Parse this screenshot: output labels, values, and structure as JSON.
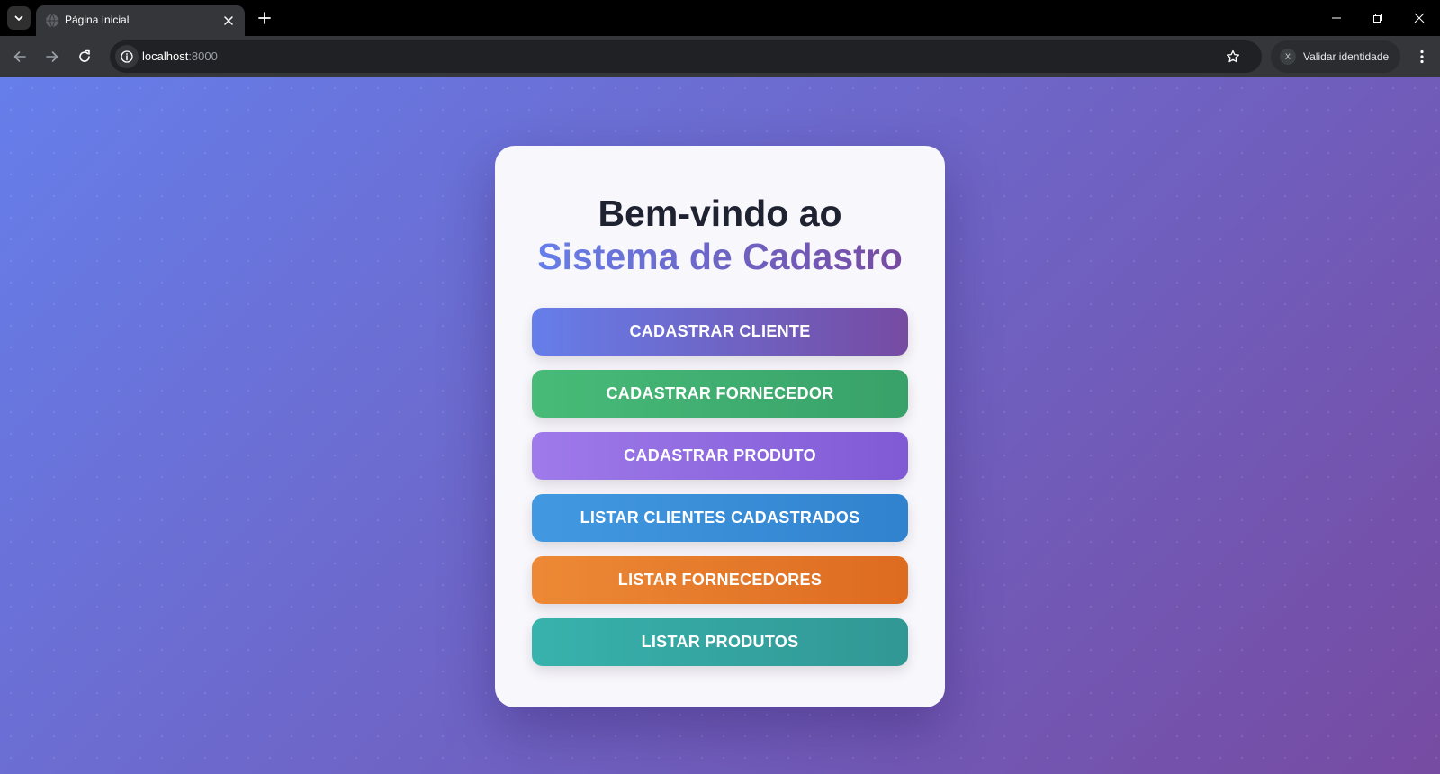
{
  "browser": {
    "tab": {
      "title": "Página Inicial",
      "favicon": "globe-icon"
    },
    "url": {
      "host": "localhost",
      "port": ":8000"
    },
    "profile": {
      "avatar_letter": "X",
      "label": "Validar identidade"
    },
    "icons": [
      "chevron-down-icon",
      "close-icon",
      "plus-icon",
      "minimize-icon",
      "restore-icon",
      "back-arrow-icon",
      "forward-arrow-icon",
      "reload-icon",
      "info-icon",
      "star-icon",
      "kebab-menu-icon"
    ]
  },
  "page": {
    "title_line1": "Bem-vindo ao",
    "title_line2": "Sistema de Cadastro",
    "buttons": [
      {
        "label": "CADASTRAR CLIENTE",
        "color_from": "#667eea",
        "color_to": "#764ba2"
      },
      {
        "label": "CADASTRAR FORNECEDOR",
        "color_from": "#48bb78",
        "color_to": "#38a169"
      },
      {
        "label": "CADASTRAR PRODUTO",
        "color_from": "#9f7aea",
        "color_to": "#805ad5"
      },
      {
        "label": "LISTAR CLIENTES CADASTRADOS",
        "color_from": "#4299e1",
        "color_to": "#3182ce"
      },
      {
        "label": "LISTAR FORNECEDORES",
        "color_from": "#ed8936",
        "color_to": "#dd6b20"
      },
      {
        "label": "LISTAR PRODUTOS",
        "color_from": "#38b2ac",
        "color_to": "#319795"
      }
    ],
    "colors": {
      "background_from": "#667eea",
      "background_to": "#764ba2",
      "card": "#f8f7fc",
      "title_dark": "#1f2230"
    }
  }
}
